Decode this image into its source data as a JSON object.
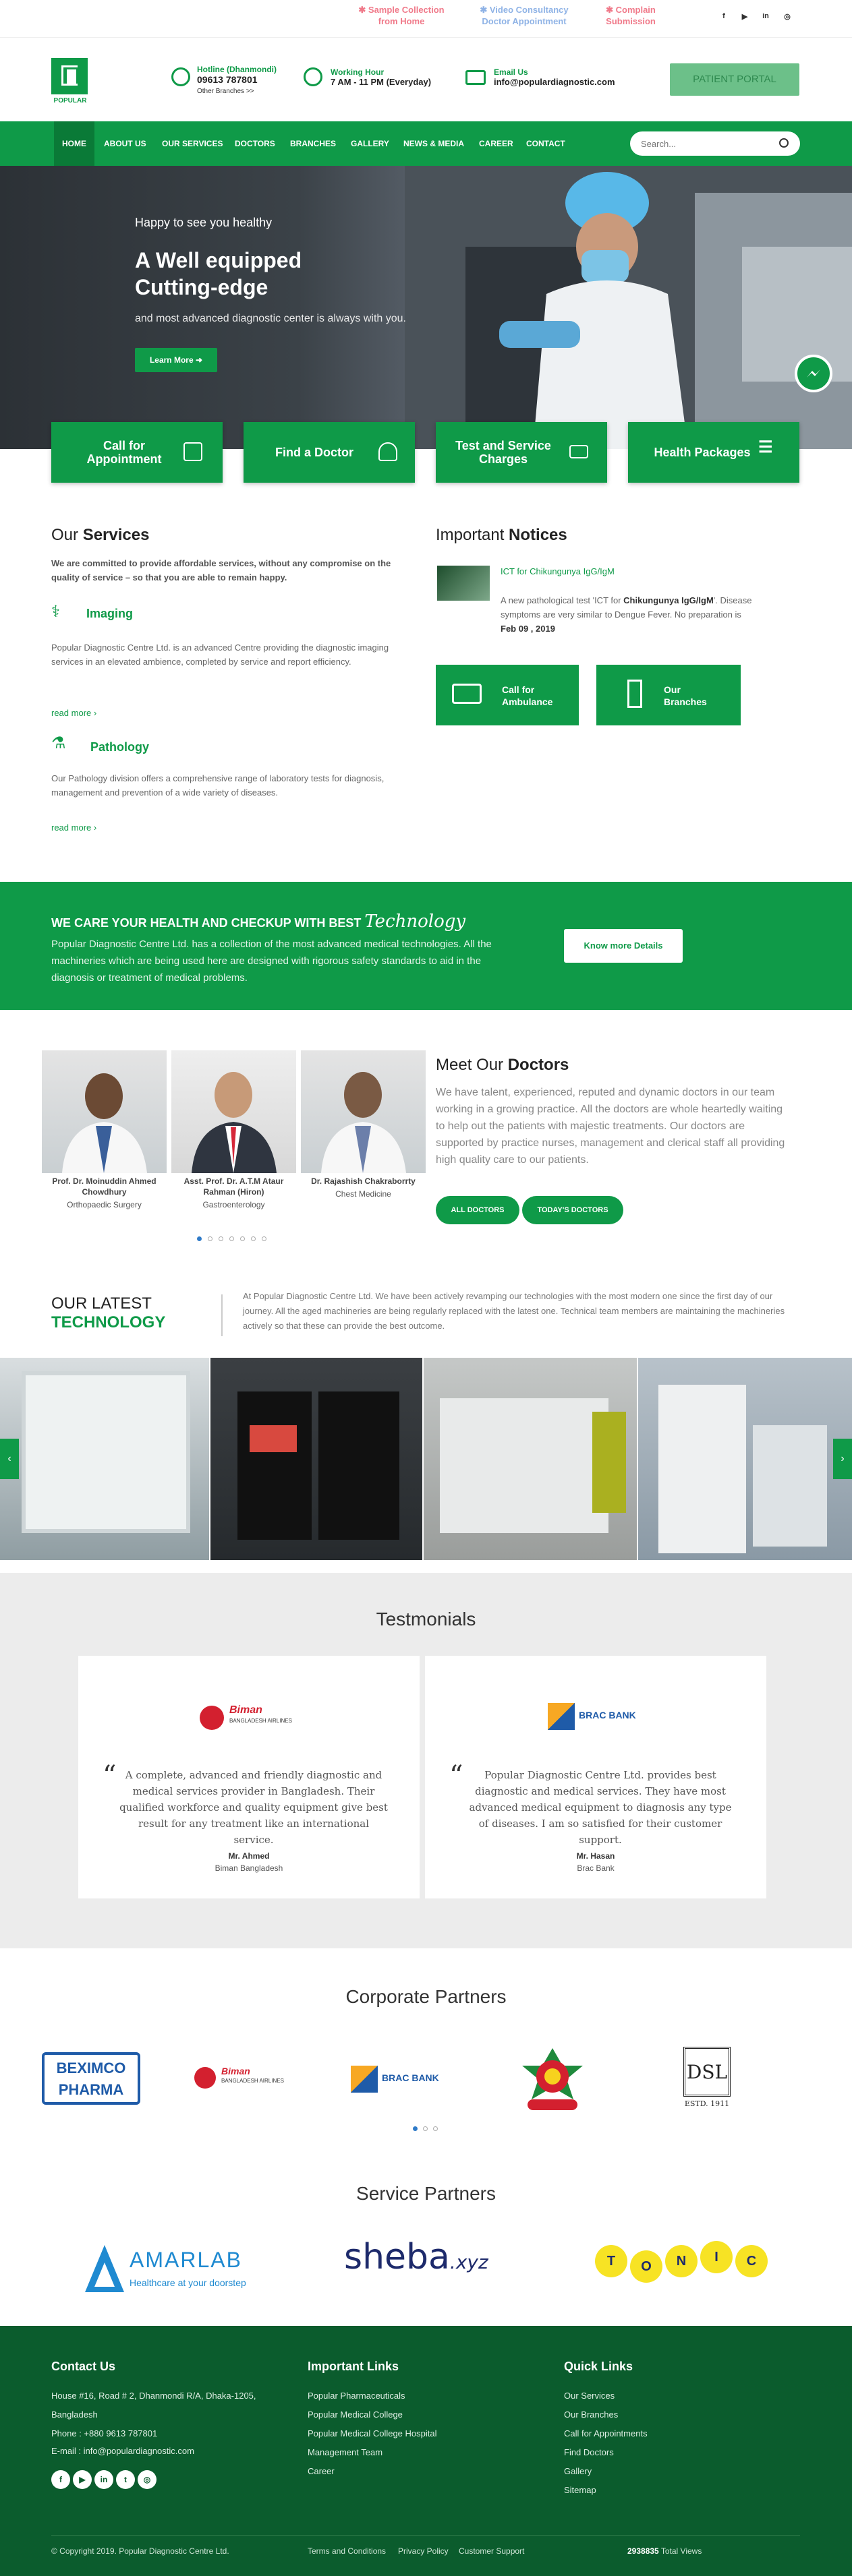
{
  "topbar": {
    "links": [
      {
        "line1": "Sample Collection",
        "line2": "from Home",
        "color": "#f07a8a"
      },
      {
        "line1": "Video Consultancy",
        "line2": "Doctor Appointment",
        "color": "#8fb3e6"
      },
      {
        "line1": "Complain",
        "line2": "Submission",
        "color": "#f07a8a"
      }
    ],
    "social": [
      "f",
      "▶",
      "in",
      "◎"
    ]
  },
  "header": {
    "logo_text": "POPULAR",
    "hotline_title": "Hotline (Dhanmondi)",
    "hotline_value": "09613 787801",
    "other_branches": "Other Branches >>",
    "hour_title": "Working Hour",
    "hour_value": "7 AM - 11 PM (Everyday)",
    "email_title": "Email Us",
    "email_value": "info@populardiagnostic.com",
    "portal_label": "PATIENT PORTAL"
  },
  "nav": {
    "items": [
      "HOME",
      "ABOUT US",
      "OUR SERVICES",
      "DOCTORS",
      "BRANCHES",
      "GALLERY",
      "NEWS & MEDIA",
      "CAREER",
      "CONTACT"
    ],
    "search_placeholder": "Search..."
  },
  "hero": {
    "tagline": "Happy to see you healthy",
    "title1": "A Well equipped",
    "title2": "Cutting-edge",
    "subtitle": "and most advanced diagnostic center is always with you.",
    "button": "Learn More"
  },
  "features": [
    {
      "label": "Call for Appointment"
    },
    {
      "label": "Find a Doctor"
    },
    {
      "label": "Test and Service Charges"
    },
    {
      "label": "Health Packages"
    }
  ],
  "services": {
    "title_plain": "Our ",
    "title_bold": "Services",
    "intro": "We are committed to provide affordable services, without any compromise on the quality of service – so that you are able to remain happy.",
    "items": [
      {
        "name": "Imaging",
        "text": "Popular Diagnostic Centre Ltd. is an advanced Centre providing the diagnostic imaging services in an elevated ambience, completed by service and report efficiency.",
        "readmore": "read more"
      },
      {
        "name": "Pathology",
        "text": "Our Pathology division offers a comprehensive range of laboratory tests for diagnosis, management and prevention of a wide variety of diseases.",
        "readmore": "read more"
      }
    ]
  },
  "notices": {
    "title_plain": "Important ",
    "title_bold": "Notices",
    "item_title": "ICT for Chikungunya IgG/IgM",
    "item_text_a": "A new pathological test 'ICT for ",
    "item_text_b": "Chikungunya IgG/IgM",
    "item_text_c": "'. Disease symptoms are very similar to Dengue Fever. No preparation is",
    "item_date": "Feb 09 , 2019",
    "btn_ambulance": "Call for Ambulance",
    "btn_branches": "Our Branches"
  },
  "care": {
    "heading": "WE CARE YOUR HEALTH AND CHECKUP WITH BEST",
    "heading_script": "Technology",
    "text": "Popular Diagnostic Centre Ltd. has a collection of the most advanced medical technologies. All the machineries which are being used here are designed with rigorous safety standards to aid in the diagnosis or treatment of medical problems.",
    "button": "Know more Details"
  },
  "doctors": {
    "list": [
      {
        "name": "Prof. Dr. Moinuddin Ahmed Chowdhury",
        "specialty": "Orthopaedic Surgery"
      },
      {
        "name": "Asst. Prof. Dr. A.T.M Ataur Rahman (Hiron)",
        "specialty": "Gastroenterology"
      },
      {
        "name": "Dr. Rajashish Chakraborrty",
        "specialty": "Chest Medicine"
      }
    ],
    "title_plain": "Meet Our ",
    "title_bold": "Doctors",
    "text": "We have talent, experienced, reputed and dynamic doctors in our team working in a growing practice. All the doctors are whole heartedly waiting to help out the patients with majestic treatments. Our doctors are supported by practice nurses, management and clerical staff all providing high quality care to our patients.",
    "btn_all": "ALL DOCTORS",
    "btn_today": "TODAY'S DOCTORS"
  },
  "technology": {
    "title1": "OUR LATEST",
    "title2": "TECHNOLOGY",
    "text": "At Popular Diagnostic Centre Ltd. We have been actively revamping our technologies with the most modern one since the first day of our journey. All the aged machineries are being regularly replaced with the latest one. Technical team members are maintaining the machineries actively so that these can provide the best outcome."
  },
  "testimonials": {
    "title": "Testmonials",
    "items": [
      {
        "logo": "Biman",
        "logo_sub": "BANGLADESH AIRLINES",
        "quote": "A complete, advanced and friendly diagnostic and medical services provider in Bangladesh. Their qualified workforce and quality equipment give best result for any treatment like an international service.",
        "name": "Mr. Ahmed",
        "company": "Biman Bangladesh"
      },
      {
        "logo": "BRAC BANK",
        "logo_sub": "",
        "quote": "Popular Diagnostic Centre Ltd. provides best diagnostic and medical services. They have most advanced medical equipment to diagnosis any type of diseases. I am so satisfied for their customer support.",
        "name": "Mr. Hasan",
        "company": "Brac Bank"
      }
    ]
  },
  "corporate": {
    "title": "Corporate Partners",
    "logos": [
      {
        "l1": "BEXIMCO",
        "l2": "PHARMA"
      },
      {
        "l1": "Biman",
        "l2": "BANGLADESH AIRLINES"
      },
      {
        "l1": "BRAC BANK",
        "l2": ""
      },
      {
        "l1": "",
        "l2": ""
      },
      {
        "l1": "DSL",
        "l2": "ESTD. 1911"
      }
    ]
  },
  "service_partners": {
    "title": "Service Partners",
    "amarlab": "AMARLAB",
    "amarlab_sub": "Healthcare at your doorstep",
    "sheba": "sheba",
    "sheba_suffix": ".xyz",
    "tonic": [
      "T",
      "O",
      "N",
      "I",
      "C"
    ]
  },
  "footer": {
    "contact_title": "Contact Us",
    "address1": "House #16, Road # 2, Dhanmondi R/A, Dhaka-1205,",
    "address2": "Bangladesh",
    "phone": "Phone : +880 9613 787801",
    "email": "E-mail : info@populardiagnostic.com",
    "links_title": "Important Links",
    "links": [
      "Popular Pharmaceuticals",
      "Popular Medical College",
      "Popular Medical College Hospital",
      "Management Team",
      "Career"
    ],
    "quick_title": "Quick Links",
    "quick": [
      "Our Services",
      "Our Branches",
      "Call for Appointments",
      "Find Doctors",
      "Gallery",
      "Sitemap"
    ],
    "social": [
      "f",
      "▶",
      "in",
      "t",
      "◎"
    ],
    "copyright": "© Copyright 2019. Popular Diagnostic Centre Ltd.",
    "bottom_links": [
      "Terms and Conditions",
      "Privacy Policy",
      "Customer Support"
    ],
    "views_count": "2938835",
    "views_label": "Total Views"
  },
  "colors": {
    "brand": "#0f9a48",
    "brand_dark": "#0b5c2d"
  }
}
